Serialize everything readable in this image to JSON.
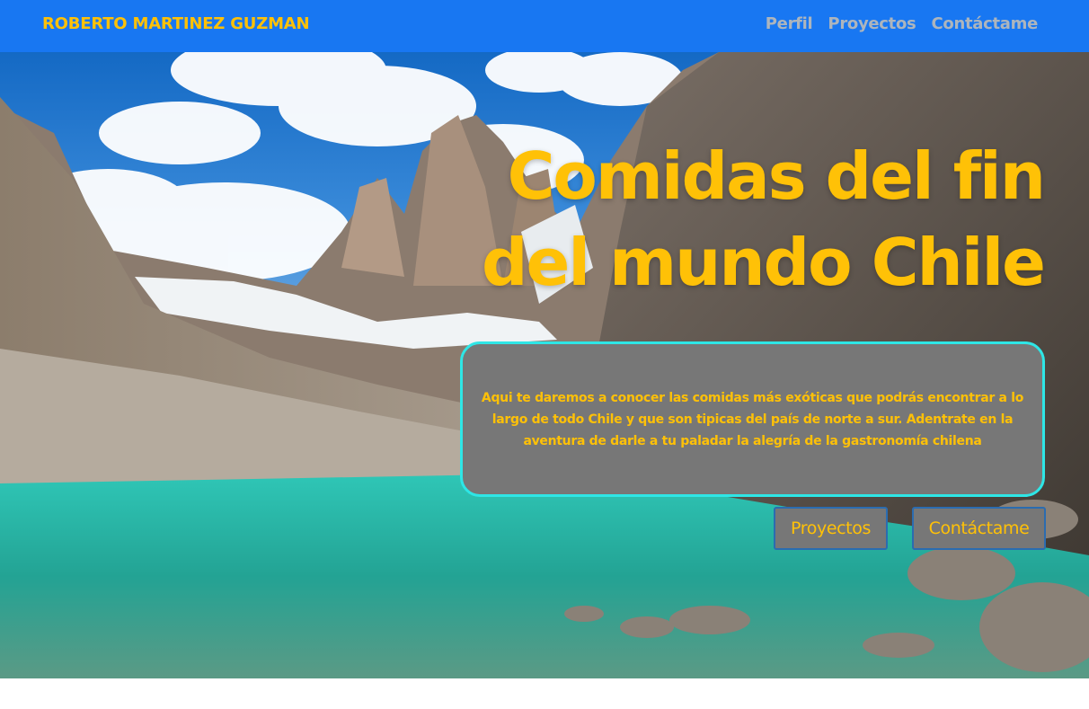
{
  "navbar": {
    "brand": "ROBERTO MARTINEZ GUZMAN",
    "links": [
      {
        "label": "Perfil"
      },
      {
        "label": "Proyectos"
      },
      {
        "label": "Contáctame"
      }
    ]
  },
  "hero": {
    "title": "Comidas del fin del mundo Chile",
    "description": "Aqui te daremos a conocer las comidas más exóticas que podrás encontrar a lo largo de todo Chile y que son tipicas del país de norte a sur. Adentrate en la aventura de darle a tu paladar la alegría de la gastronomía chilena",
    "buttons": {
      "projects": "Proyectos",
      "contact": "Contáctame"
    },
    "background_image": "patagonian-mountains-lake-landscape"
  },
  "colors": {
    "navbar_bg": "#1877f2",
    "accent_yellow": "#ffc107",
    "nav_link_gray": "#adb5bd",
    "box_bg": "#777777",
    "box_border": "#2ee6e6"
  }
}
